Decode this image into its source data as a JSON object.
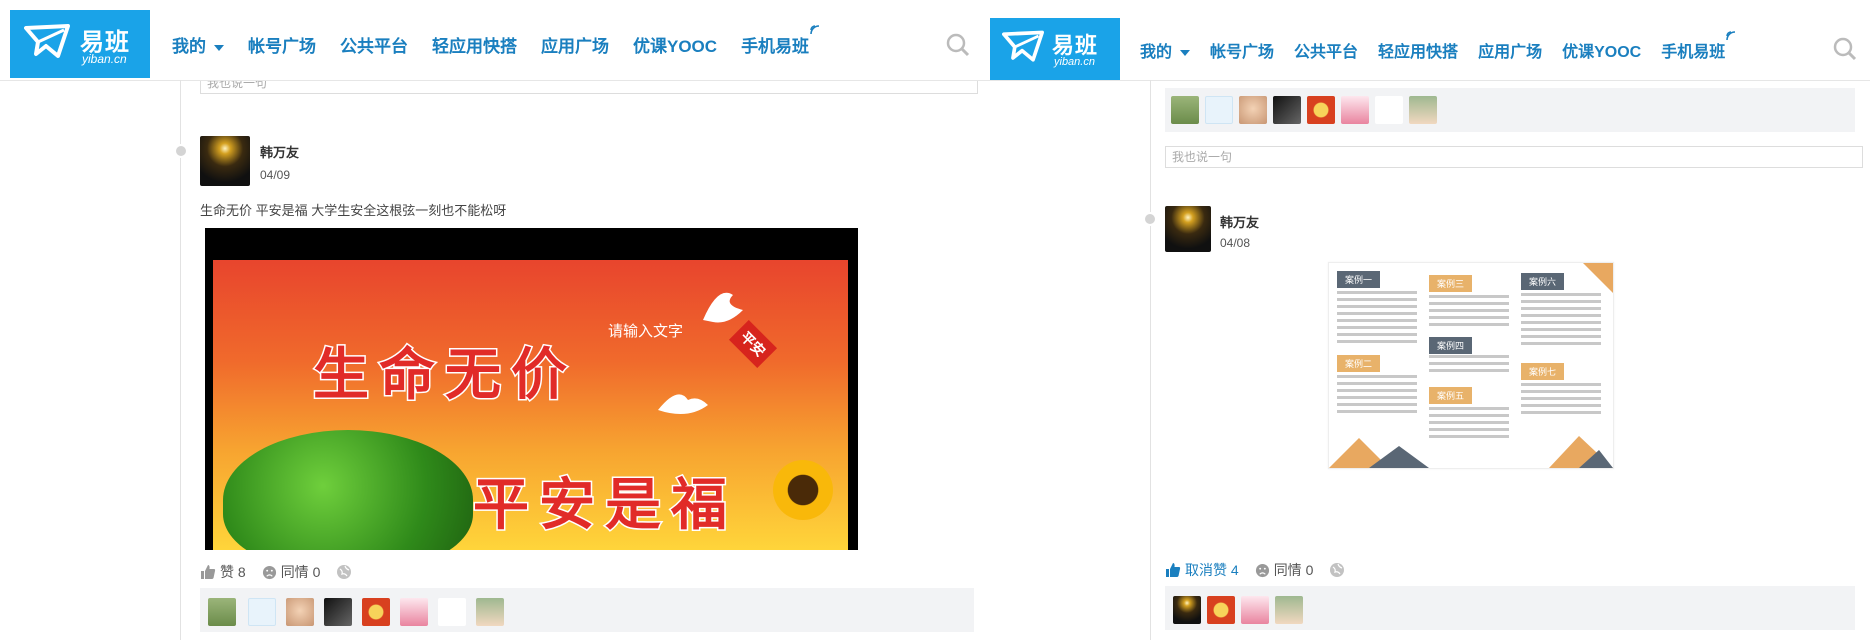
{
  "brand": {
    "name": "易班",
    "domain": "yiban.cn",
    "color": "#1aa3e8",
    "nav_color": "#1a7fbf"
  },
  "nav": {
    "items": [
      "我的",
      "帐号广场",
      "公共平台",
      "轻应用快搭",
      "应用广场",
      "优课YOOC",
      "手机易班"
    ]
  },
  "comment_placeholder": "我也说一句",
  "left_post": {
    "author": "韩万友",
    "date": "04/09",
    "text": "生命无价 平安是福 大学生安全这根弦一刻也不能松呀",
    "image": {
      "line1": "生命无价",
      "line2": "平安是福",
      "placeholder": "请输入文字",
      "stamp": "平安"
    },
    "like_label": "赞",
    "like_count": "8",
    "sympathy_label": "同情",
    "sympathy_count": "0"
  },
  "right_post": {
    "author": "韩万友",
    "date": "04/08",
    "unlike_label": "取消赞",
    "like_count": "4",
    "sympathy_label": "同情",
    "sympathy_count": "0",
    "brochure_tags": [
      "案例一",
      "案例二",
      "案例三",
      "案例四",
      "案例五",
      "案例六",
      "案例七"
    ]
  },
  "icons": [
    "search-icon",
    "thumbs-up-icon",
    "sad-face-icon",
    "globe-icon",
    "wifi-icon",
    "caret-down-icon"
  ]
}
